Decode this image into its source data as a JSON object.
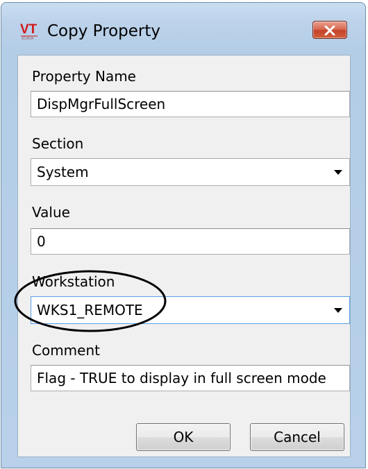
{
  "window": {
    "title": "Copy Property",
    "icon": "vt-app-icon",
    "close_icon": "close-icon"
  },
  "fields": {
    "property_name": {
      "label": "Property Name",
      "value": "DispMgrFullScreen"
    },
    "section": {
      "label": "Section",
      "value": "System"
    },
    "value": {
      "label": "Value",
      "value": "0"
    },
    "workstation": {
      "label": "Workstation",
      "value": "WKS1_REMOTE"
    },
    "comment": {
      "label": "Comment",
      "value": "Flag - TRUE to display in full screen mode"
    }
  },
  "buttons": {
    "ok": "OK",
    "cancel": "Cancel"
  },
  "colors": {
    "title_bar": "#bcd2ea",
    "client_bg": "#f0f0f0",
    "close_button": "#c4432a",
    "annotation_ellipse": "#000000",
    "focus_border": "#569de5"
  }
}
